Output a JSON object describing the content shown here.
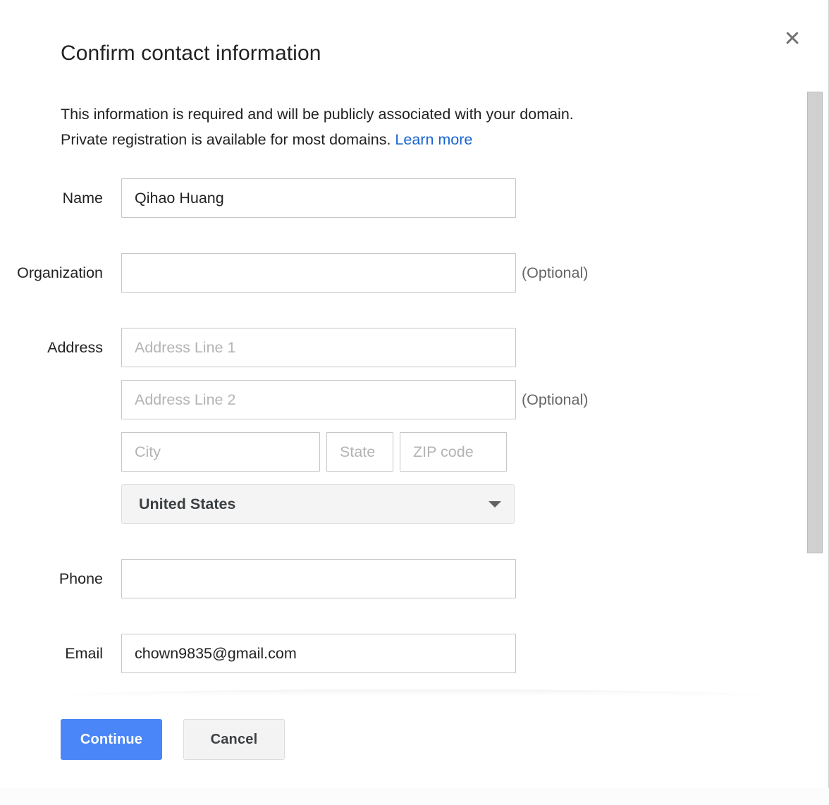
{
  "dialog": {
    "title": "Confirm contact information",
    "close_label": "Close",
    "description_line1": "This information is required and will be publicly associated with your domain.",
    "description_line2": "Private registration is available for most domains.",
    "learn_more_label": "Learn more"
  },
  "form": {
    "name": {
      "label": "Name",
      "value": "Qihao Huang",
      "placeholder": ""
    },
    "organization": {
      "label": "Organization",
      "value": "",
      "placeholder": "",
      "optional_note": "(Optional)"
    },
    "address": {
      "label": "Address",
      "line1": {
        "value": "",
        "placeholder": "Address Line 1"
      },
      "line2": {
        "value": "",
        "placeholder": "Address Line 2",
        "optional_note": "(Optional)"
      },
      "city": {
        "value": "",
        "placeholder": "City"
      },
      "state": {
        "value": "",
        "placeholder": "State"
      },
      "zip": {
        "value": "",
        "placeholder": "ZIP code"
      },
      "country": {
        "selected": "United States"
      }
    },
    "phone": {
      "label": "Phone",
      "value": "",
      "placeholder": ""
    },
    "email": {
      "label": "Email",
      "value": "chown9835@gmail.com",
      "placeholder": ""
    }
  },
  "footer": {
    "continue_label": "Continue",
    "cancel_label": "Cancel"
  },
  "colors": {
    "primary_button": "#4a86f7",
    "link": "#1763d1",
    "input_border": "#c6c6c6",
    "placeholder": "#b4b4b4",
    "select_background": "#f4f4f4",
    "scrollbar_thumb": "#d0d0d0"
  }
}
